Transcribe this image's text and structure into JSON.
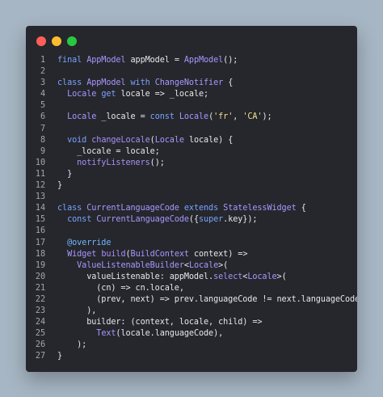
{
  "window": {
    "traffic_lights": [
      {
        "name": "close",
        "color": "#ff5f57"
      },
      {
        "name": "minimize",
        "color": "#febc2e"
      },
      {
        "name": "zoom",
        "color": "#28c840"
      }
    ]
  },
  "lines": [
    {
      "n": "1",
      "tokens": [
        {
          "t": "final ",
          "c": "kw"
        },
        {
          "t": "AppModel",
          "c": "type"
        },
        {
          "t": " appModel = ",
          "c": "plain"
        },
        {
          "t": "AppModel",
          "c": "type"
        },
        {
          "t": "();",
          "c": "plain"
        }
      ]
    },
    {
      "n": "2",
      "tokens": []
    },
    {
      "n": "3",
      "tokens": [
        {
          "t": "class ",
          "c": "kw"
        },
        {
          "t": "AppModel",
          "c": "type"
        },
        {
          "t": " with ",
          "c": "kw"
        },
        {
          "t": "ChangeNotifier",
          "c": "type"
        },
        {
          "t": " {",
          "c": "plain"
        }
      ]
    },
    {
      "n": "4",
      "tokens": [
        {
          "t": "  ",
          "c": "plain"
        },
        {
          "t": "Locale",
          "c": "type"
        },
        {
          "t": " get ",
          "c": "kw"
        },
        {
          "t": "locale => _locale;",
          "c": "plain"
        }
      ]
    },
    {
      "n": "5",
      "tokens": []
    },
    {
      "n": "6",
      "tokens": [
        {
          "t": "  ",
          "c": "plain"
        },
        {
          "t": "Locale",
          "c": "type"
        },
        {
          "t": " _locale = ",
          "c": "plain"
        },
        {
          "t": "const ",
          "c": "kw"
        },
        {
          "t": "Locale",
          "c": "type"
        },
        {
          "t": "(",
          "c": "plain"
        },
        {
          "t": "'fr'",
          "c": "str"
        },
        {
          "t": ", ",
          "c": "plain"
        },
        {
          "t": "'CA'",
          "c": "str"
        },
        {
          "t": ");",
          "c": "plain"
        }
      ]
    },
    {
      "n": "7",
      "tokens": []
    },
    {
      "n": "8",
      "tokens": [
        {
          "t": "  ",
          "c": "plain"
        },
        {
          "t": "void ",
          "c": "kw"
        },
        {
          "t": "changeLocale",
          "c": "fn"
        },
        {
          "t": "(",
          "c": "plain"
        },
        {
          "t": "Locale",
          "c": "type"
        },
        {
          "t": " locale) {",
          "c": "plain"
        }
      ]
    },
    {
      "n": "9",
      "tokens": [
        {
          "t": "    _locale = locale;",
          "c": "plain"
        }
      ]
    },
    {
      "n": "10",
      "tokens": [
        {
          "t": "    ",
          "c": "plain"
        },
        {
          "t": "notifyListeners",
          "c": "fn"
        },
        {
          "t": "();",
          "c": "plain"
        }
      ]
    },
    {
      "n": "11",
      "tokens": [
        {
          "t": "  }",
          "c": "plain"
        }
      ]
    },
    {
      "n": "12",
      "tokens": [
        {
          "t": "}",
          "c": "plain"
        }
      ]
    },
    {
      "n": "13",
      "tokens": []
    },
    {
      "n": "14",
      "tokens": [
        {
          "t": "class ",
          "c": "kw"
        },
        {
          "t": "CurrentLanguageCode",
          "c": "type"
        },
        {
          "t": " extends ",
          "c": "kw"
        },
        {
          "t": "StatelessWidget",
          "c": "type"
        },
        {
          "t": " {",
          "c": "plain"
        }
      ]
    },
    {
      "n": "15",
      "tokens": [
        {
          "t": "  ",
          "c": "plain"
        },
        {
          "t": "const ",
          "c": "kw"
        },
        {
          "t": "CurrentLanguageCode",
          "c": "type"
        },
        {
          "t": "({",
          "c": "plain"
        },
        {
          "t": "super",
          "c": "kw"
        },
        {
          "t": ".key});",
          "c": "plain"
        }
      ]
    },
    {
      "n": "16",
      "tokens": []
    },
    {
      "n": "17",
      "tokens": [
        {
          "t": "  ",
          "c": "plain"
        },
        {
          "t": "@override",
          "c": "ann"
        }
      ]
    },
    {
      "n": "18",
      "tokens": [
        {
          "t": "  ",
          "c": "plain"
        },
        {
          "t": "Widget",
          "c": "type"
        },
        {
          "t": " ",
          "c": "plain"
        },
        {
          "t": "build",
          "c": "fn"
        },
        {
          "t": "(",
          "c": "plain"
        },
        {
          "t": "BuildContext",
          "c": "type"
        },
        {
          "t": " context) =>",
          "c": "plain"
        }
      ]
    },
    {
      "n": "19",
      "tokens": [
        {
          "t": "    ",
          "c": "plain"
        },
        {
          "t": "ValueListenableBuilder",
          "c": "type"
        },
        {
          "t": "<",
          "c": "plain"
        },
        {
          "t": "Locale",
          "c": "type"
        },
        {
          "t": ">(",
          "c": "plain"
        }
      ]
    },
    {
      "n": "20",
      "tokens": [
        {
          "t": "      valueListenable: appModel.",
          "c": "plain"
        },
        {
          "t": "select",
          "c": "fn"
        },
        {
          "t": "<",
          "c": "plain"
        },
        {
          "t": "Locale",
          "c": "type"
        },
        {
          "t": ">(",
          "c": "plain"
        }
      ]
    },
    {
      "n": "21",
      "tokens": [
        {
          "t": "        (cn) => cn.locale,",
          "c": "plain"
        }
      ]
    },
    {
      "n": "22",
      "tokens": [
        {
          "t": "        (prev, next) => prev.languageCode != next.languageCode,",
          "c": "plain"
        }
      ]
    },
    {
      "n": "23",
      "tokens": [
        {
          "t": "      ),",
          "c": "plain"
        }
      ]
    },
    {
      "n": "24",
      "tokens": [
        {
          "t": "      builder: (context, locale, child) =>",
          "c": "plain"
        }
      ]
    },
    {
      "n": "25",
      "tokens": [
        {
          "t": "        ",
          "c": "plain"
        },
        {
          "t": "Text",
          "c": "type"
        },
        {
          "t": "(locale.languageCode),",
          "c": "plain"
        }
      ]
    },
    {
      "n": "26",
      "tokens": [
        {
          "t": "    );",
          "c": "plain"
        }
      ]
    },
    {
      "n": "27",
      "tokens": [
        {
          "t": "}",
          "c": "plain"
        }
      ]
    }
  ]
}
